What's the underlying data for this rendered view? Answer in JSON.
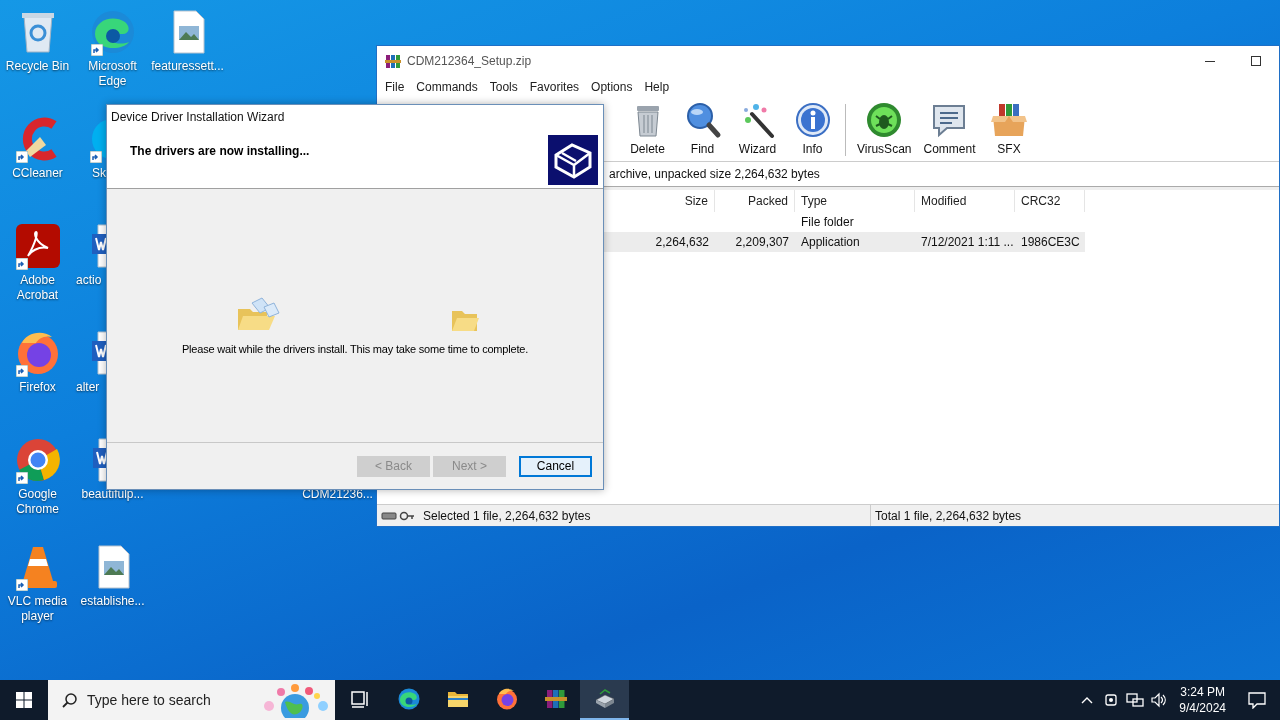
{
  "desktop": {
    "icons": [
      {
        "label": "Recycle Bin",
        "kind": "recycle-bin",
        "shortcut": false
      },
      {
        "label": "CCleaner",
        "kind": "ccleaner",
        "shortcut": true
      },
      {
        "label": "Adobe Acrobat",
        "kind": "acrobat",
        "shortcut": true
      },
      {
        "label": "Firefox",
        "kind": "firefox",
        "shortcut": true
      },
      {
        "label": "Google Chrome",
        "kind": "chrome",
        "shortcut": true
      },
      {
        "label": "VLC media player",
        "kind": "vlc",
        "shortcut": true
      },
      {
        "label": "Microsoft Edge",
        "kind": "edge",
        "shortcut": true
      },
      {
        "label": "Sk",
        "kind": "skype",
        "shortcut": true
      },
      {
        "label": "actio",
        "kind": "word",
        "shortcut": false
      },
      {
        "label": "alter",
        "kind": "word",
        "shortcut": false
      },
      {
        "label": "beautifulp...",
        "kind": "word",
        "shortcut": false
      },
      {
        "label": "establishe...",
        "kind": "image-file",
        "shortcut": false
      },
      {
        "label": "featuressett...",
        "kind": "image-file",
        "shortcut": false
      },
      {
        "label": "CDM21236...",
        "shortcut": false
      }
    ]
  },
  "archive_window": {
    "title": "CDM212364_Setup.zip",
    "menu": [
      "File",
      "Commands",
      "Tools",
      "Favorites",
      "Options",
      "Help"
    ],
    "toolbar": [
      {
        "label": "Delete",
        "kind": "delete"
      },
      {
        "label": "Find",
        "kind": "find"
      },
      {
        "label": "Wizard",
        "kind": "wizard"
      },
      {
        "label": "Info",
        "kind": "info"
      },
      {
        "label": "VirusScan",
        "kind": "virusscan"
      },
      {
        "label": "Comment",
        "kind": "comment"
      },
      {
        "label": "SFX",
        "kind": "sfx"
      }
    ],
    "address": "archive, unpacked size 2,264,632 bytes",
    "columns": [
      {
        "label": "Size",
        "numeric": true
      },
      {
        "label": "Packed",
        "numeric": true
      },
      {
        "label": "Type",
        "numeric": false
      },
      {
        "label": "Modified",
        "numeric": false
      },
      {
        "label": "CRC32",
        "numeric": false
      }
    ],
    "rows": [
      {
        "cells": [
          null,
          null,
          "File folder",
          null,
          null
        ],
        "selected": false
      },
      {
        "cells": [
          "2,264,632",
          "2,209,307",
          "Application",
          "7/12/2021 1:11 ...",
          "1986CE3C"
        ],
        "selected": true
      }
    ],
    "status_left": "Selected 1 file, 2,264,632 bytes",
    "status_right": "Total 1 file, 2,264,632 bytes"
  },
  "wizard": {
    "title": "Device Driver Installation Wizard",
    "heading": "The drivers are now installing...",
    "message": "Please wait while the drivers install. This may take some time to complete.",
    "buttons": [
      {
        "label": "< Back",
        "disabled": true,
        "default": false
      },
      {
        "label": "Next >",
        "disabled": true,
        "default": false
      },
      {
        "label": "Cancel",
        "disabled": false,
        "default": true
      }
    ]
  },
  "taskbar": {
    "search_placeholder": "Type here to search",
    "apps": [
      {
        "kind": "edge",
        "selected": false
      },
      {
        "kind": "explorer",
        "selected": false
      },
      {
        "kind": "firefox",
        "selected": false
      },
      {
        "kind": "winrar",
        "selected": false
      },
      {
        "kind": "installer",
        "selected": true
      }
    ],
    "time": "3:24 PM",
    "date": "9/4/2024"
  }
}
